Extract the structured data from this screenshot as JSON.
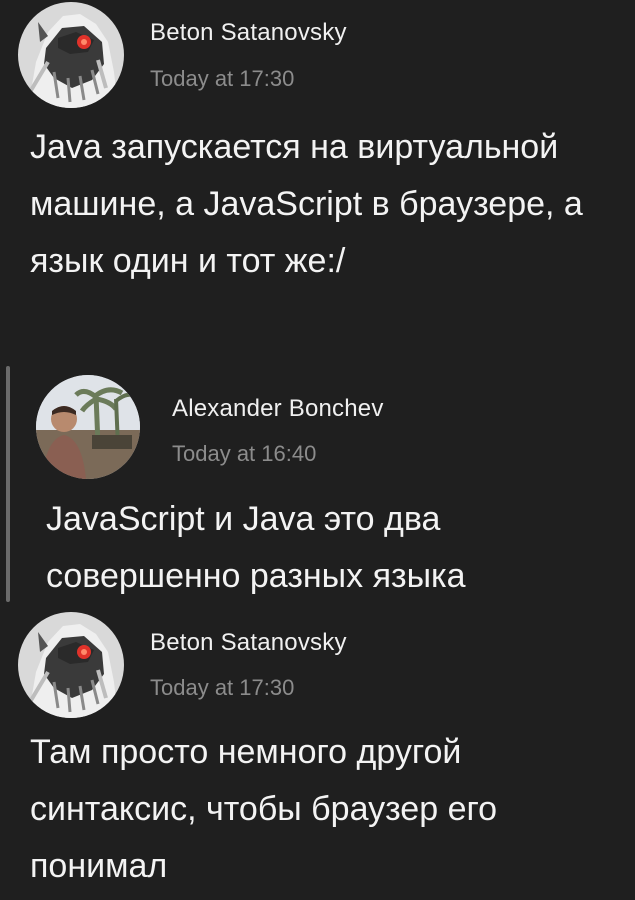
{
  "messages": [
    {
      "author": "Beton Satanovsky",
      "timestamp": "Today at 17:30",
      "avatar_icon": "wolf-avatar-icon",
      "text": "Java запускается на виртуальной машине, а JavaScript в браузере, а язык один и тот же:/"
    },
    {
      "author": "Alexander Bonchev",
      "timestamp": "Today at 16:40",
      "avatar_icon": "photo-avatar-icon",
      "text": "JavaScript и Java это два совершенно разных языка"
    },
    {
      "author": "Beton Satanovsky",
      "timestamp": "Today at 17:30",
      "avatar_icon": "wolf-avatar-icon",
      "text": "Там просто немного другой синтаксис, чтобы браузер его понимал"
    }
  ],
  "colors": {
    "background": "#1f1f1f",
    "text": "#f3f3f3",
    "timestamp": "#8c8c8c",
    "quote_bar": "#6b6b6b",
    "wolf_eye": "#e0322a"
  }
}
